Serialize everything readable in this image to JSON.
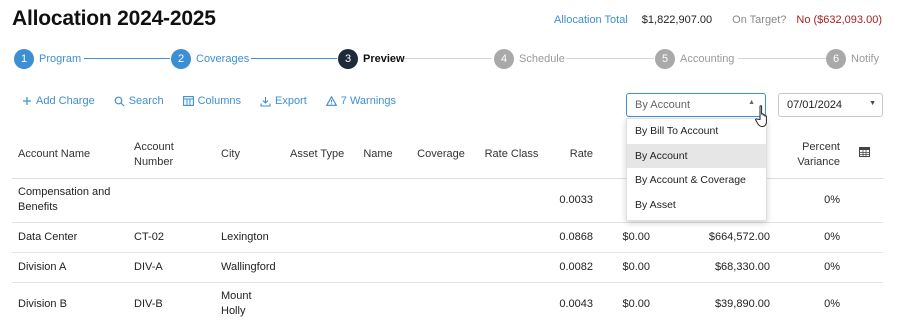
{
  "header": {
    "title": "Allocation 2024-2025",
    "allocation_total_label": "Allocation Total",
    "allocation_total_value": "$1,822,907.00",
    "on_target_label": "On Target?",
    "on_target_value": "No ($632,093.00)"
  },
  "steps": [
    {
      "num": "1",
      "label": "Program",
      "state": "done"
    },
    {
      "num": "2",
      "label": "Coverages",
      "state": "done"
    },
    {
      "num": "3",
      "label": "Preview",
      "state": "active"
    },
    {
      "num": "4",
      "label": "Schedule",
      "state": "todo"
    },
    {
      "num": "5",
      "label": "Accounting",
      "state": "todo"
    },
    {
      "num": "6",
      "label": "Notify",
      "state": "todo"
    }
  ],
  "toolbar": {
    "add_charge": "Add Charge",
    "search": "Search",
    "columns": "Columns",
    "export": "Export",
    "warnings": "7 Warnings"
  },
  "group_by": {
    "selected": "By Account",
    "options": [
      "By Bill To Account",
      "By Account",
      "By Account & Coverage",
      "By Asset"
    ]
  },
  "date": "07/01/2024",
  "table": {
    "columns": [
      "Account Name",
      "Account Number",
      "City",
      "Asset Type",
      "Name",
      "Coverage",
      "Rate Class",
      "Rate",
      "P",
      "",
      "Percent Variance"
    ],
    "rows": [
      {
        "account_name": "Compensation and Benefits",
        "account_number": "",
        "city": "",
        "rate": "0.0033",
        "prior": "",
        "amount": "",
        "variance": "0%"
      },
      {
        "account_name": "Data Center",
        "account_number": "CT-02",
        "city": "Lexington",
        "rate": "0.0868",
        "prior": "$0.00",
        "amount": "$664,572.00",
        "variance": "0%"
      },
      {
        "account_name": "Division A",
        "account_number": "DIV-A",
        "city": "Wallingford",
        "rate": "0.0082",
        "prior": "$0.00",
        "amount": "$68,330.00",
        "variance": "0%"
      },
      {
        "account_name": "Division B",
        "account_number": "DIV-B",
        "city": "Mount Holly",
        "rate": "0.0043",
        "prior": "$0.00",
        "amount": "$39,890.00",
        "variance": "0%"
      }
    ]
  },
  "colors": {
    "accent": "#3d8fd4",
    "active_step": "#1e2a3a",
    "negative": "#a81e1e"
  }
}
